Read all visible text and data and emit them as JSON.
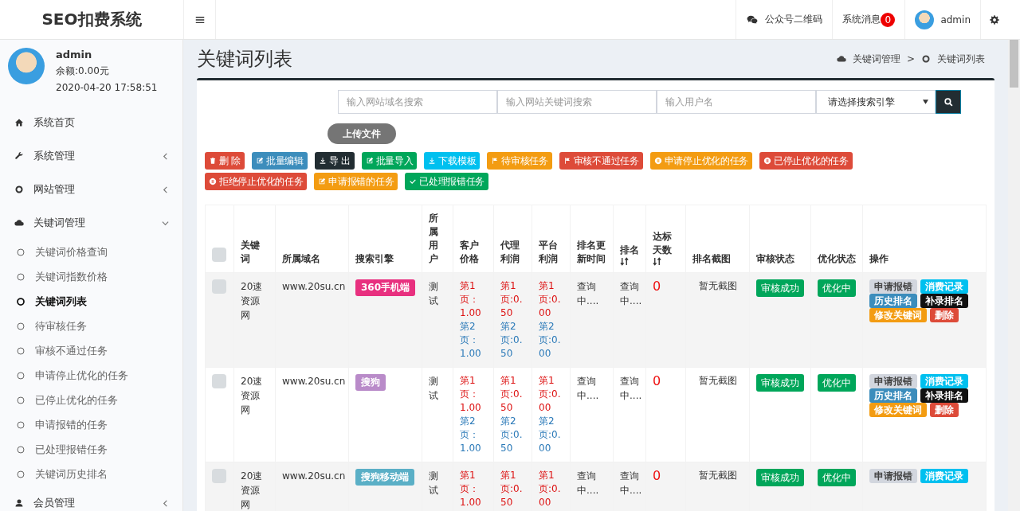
{
  "app": {
    "title": "SEO扣费系统"
  },
  "topbar": {
    "items": [
      {
        "kind": "wechat",
        "label": "公众号二维码"
      },
      {
        "kind": "messages",
        "label": "系统消息",
        "badge": "0"
      },
      {
        "kind": "user",
        "label": "admin"
      },
      {
        "kind": "settings"
      }
    ]
  },
  "user_panel": {
    "name": "admin",
    "balance": "余额:0.00元",
    "time": "2020-04-20 17:58:51"
  },
  "sidebar": {
    "items": [
      {
        "label": "系统首页",
        "kind": "home"
      },
      {
        "label": "系统管理",
        "kind": "wrench",
        "expanded": false
      },
      {
        "label": "网站管理",
        "kind": "ring",
        "expanded": false
      },
      {
        "label": "关键词管理",
        "kind": "cloud",
        "expanded": true,
        "children": [
          {
            "label": "关键词价格查询",
            "selected": false
          },
          {
            "label": "关键词指数价格",
            "selected": false
          },
          {
            "label": "关键词列表",
            "selected": true
          },
          {
            "label": "待审核任务",
            "selected": false
          },
          {
            "label": "审核不通过任务",
            "selected": false
          },
          {
            "label": "申请停止优化的任务",
            "selected": false
          },
          {
            "label": "已停止优化的任务",
            "selected": false
          },
          {
            "label": "申请报错的任务",
            "selected": false
          },
          {
            "label": "已处理报错任务",
            "selected": false
          },
          {
            "label": "关键词历史排名",
            "selected": false
          }
        ]
      },
      {
        "label": "会员管理",
        "kind": "user",
        "expanded": false
      }
    ]
  },
  "page": {
    "title": "关键词列表",
    "breadcrumb": [
      {
        "kind": "cloud",
        "label": "关键词管理"
      },
      {
        "kind": "ring",
        "label": "关键词列表"
      }
    ],
    "separator": ">"
  },
  "filters": {
    "fields": [
      {
        "placeholder": "输入网站域名搜索"
      },
      {
        "placeholder": "输入网站关键词搜索"
      },
      {
        "placeholder": "输入用户名"
      }
    ],
    "select": "请选择搜索引擎"
  },
  "upload_button": "上传文件",
  "toolbar": [
    {
      "label": "删 除",
      "kind": "trash",
      "color": "#dd4b39"
    },
    {
      "label": "批量编辑",
      "kind": "edit",
      "color": "#3c8dbc"
    },
    {
      "label": "导 出",
      "kind": "download",
      "color": "#222d32"
    },
    {
      "label": "批量导入",
      "kind": "edit",
      "color": "#00a65a"
    },
    {
      "label": "下载模板",
      "kind": "download",
      "color": "#00c0ef"
    },
    {
      "label": "待审核任务",
      "kind": "flag",
      "color": "#f39c12"
    },
    {
      "label": "审核不通过任务",
      "kind": "flag",
      "color": "#dd4b39"
    },
    {
      "label": "申请停止优化的任务",
      "kind": "pause",
      "color": "#f39c12"
    },
    {
      "label": "已停止优化的任务",
      "kind": "pause",
      "color": "#dd4b39"
    },
    {
      "label": "拒绝停止优化的任务",
      "kind": "pause",
      "color": "#dd4b39"
    },
    {
      "label": "申请报错的任务",
      "kind": "edit",
      "color": "#f39c12"
    },
    {
      "label": "已处理报错任务",
      "kind": "check",
      "color": "#00a65a"
    }
  ],
  "table": {
    "header_checked": false,
    "columns": [
      {
        "label": "关键词"
      },
      {
        "label": "所属域名"
      },
      {
        "label": "搜索引擎"
      },
      {
        "label": "所属用户"
      },
      {
        "label": "客户价格"
      },
      {
        "label": "代理利润"
      },
      {
        "label": "平台利润"
      },
      {
        "label": "排名更新时间"
      },
      {
        "label": "排名",
        "sortable": true
      },
      {
        "label": "达标天数",
        "sortable": true
      },
      {
        "label": "排名截图"
      },
      {
        "label": "审核状态"
      },
      {
        "label": "优化状态"
      },
      {
        "label": "操作"
      }
    ],
    "rows": [
      {
        "checked": false,
        "keyword": "20速资源网",
        "domain": "www.20su.cn",
        "engine": {
          "label": "360手机端",
          "color": "#e8307f"
        },
        "user": "测试",
        "customer_price": [
          "第1页：1.00",
          "第2页：1.00"
        ],
        "agent_profit": [
          "第1页:0.50",
          "第2页:0.50"
        ],
        "platform_profit": [
          "第1页:0.00",
          "第2页:0.00"
        ],
        "rank_update": "查询中....",
        "rank": "查询中....",
        "days": "0",
        "screenshot": "暂无截图",
        "audit": "审核成功",
        "optimize": "优化中",
        "actions": [
          {
            "label": "申请报错",
            "color": "#d2d6de"
          },
          {
            "label": "消费记录",
            "color": "#00c0ef"
          },
          {
            "label": "历史排名",
            "color": "#3c8dbc"
          },
          {
            "label": "补录排名",
            "color": "#111111"
          },
          {
            "label": "修改关键词",
            "color": "#f39c12"
          },
          {
            "label": "删除",
            "color": "#dd4b39"
          }
        ]
      },
      {
        "checked": false,
        "keyword": "20速资源网",
        "domain": "www.20su.cn",
        "engine": {
          "label": "搜狗",
          "color": "#b98bc9"
        },
        "user": "测试",
        "customer_price": [
          "第1页：1.00",
          "第2页：1.00"
        ],
        "agent_profit": [
          "第1页:0.50",
          "第2页:0.50"
        ],
        "platform_profit": [
          "第1页:0.00",
          "第2页:0.00"
        ],
        "rank_update": "查询中....",
        "rank": "查询中....",
        "days": "0",
        "screenshot": "暂无截图",
        "audit": "审核成功",
        "optimize": "优化中",
        "actions": [
          {
            "label": "申请报错",
            "color": "#d2d6de"
          },
          {
            "label": "消费记录",
            "color": "#00c0ef"
          },
          {
            "label": "历史排名",
            "color": "#3c8dbc"
          },
          {
            "label": "补录排名",
            "color": "#111111"
          },
          {
            "label": "修改关键词",
            "color": "#f39c12"
          },
          {
            "label": "删除",
            "color": "#dd4b39"
          }
        ]
      },
      {
        "checked": false,
        "keyword": "20速资源网",
        "domain": "www.20su.cn",
        "engine": {
          "label": "搜狗移动端",
          "color": "#5aafc6"
        },
        "user": "测试",
        "customer_price": [
          "第1页：1.00"
        ],
        "agent_profit": [
          "第1页:0.50"
        ],
        "platform_profit": [
          "第1页:0.00"
        ],
        "rank_update": "查询中....",
        "rank": "查询中....",
        "days": "0",
        "screenshot": "暂无截图",
        "audit": "审核成功",
        "optimize": "优化中",
        "actions": [
          {
            "label": "申请报错",
            "color": "#d2d6de"
          },
          {
            "label": "消费记录",
            "color": "#00c0ef"
          }
        ]
      }
    ]
  }
}
